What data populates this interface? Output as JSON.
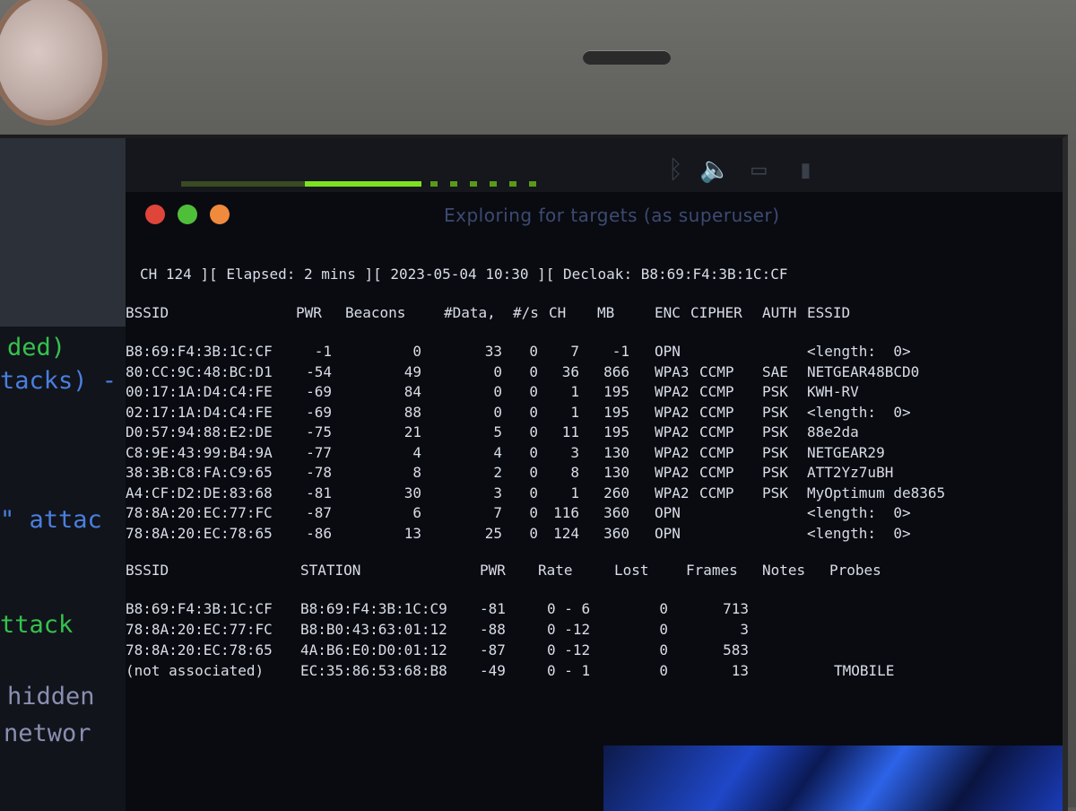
{
  "left_window": {
    "fragments": [
      "ded)",
      "tacks) -",
      "\" attac",
      "ttack",
      "hidden",
      "networ"
    ]
  },
  "terminal": {
    "title": "Exploring for targets (as superuser)",
    "status_line": "CH 124 ][ Elapsed: 2 mins ][ 2023-05-04 10:30 ][ Decloak: B8:69:F4:3B:1C:CF",
    "ap_headers": [
      "BSSID",
      "PWR",
      "Beacons",
      "#Data,",
      "#/s",
      "CH",
      "MB",
      "ENC",
      "CIPHER",
      "AUTH",
      "ESSID"
    ],
    "ap_rows": [
      [
        "B8:69:F4:3B:1C:CF",
        "-1",
        "0",
        "33",
        "0",
        "7",
        "-1",
        "OPN",
        "",
        "",
        "<length:  0>"
      ],
      [
        "80:CC:9C:48:BC:D1",
        "-54",
        "49",
        "0",
        "0",
        "36",
        "866",
        "WPA3",
        "CCMP",
        "SAE",
        "NETGEAR48BCD0"
      ],
      [
        "00:17:1A:D4:C4:FE",
        "-69",
        "84",
        "0",
        "0",
        "1",
        "195",
        "WPA2",
        "CCMP",
        "PSK",
        "KWH-RV"
      ],
      [
        "02:17:1A:D4:C4:FE",
        "-69",
        "88",
        "0",
        "0",
        "1",
        "195",
        "WPA2",
        "CCMP",
        "PSK",
        "<length:  0>"
      ],
      [
        "D0:57:94:88:E2:DE",
        "-75",
        "21",
        "5",
        "0",
        "11",
        "195",
        "WPA2",
        "CCMP",
        "PSK",
        "88e2da"
      ],
      [
        "C8:9E:43:99:B4:9A",
        "-77",
        "4",
        "4",
        "0",
        "3",
        "130",
        "WPA2",
        "CCMP",
        "PSK",
        "NETGEAR29"
      ],
      [
        "38:3B:C8:FA:C9:65",
        "-78",
        "8",
        "2",
        "0",
        "8",
        "130",
        "WPA2",
        "CCMP",
        "PSK",
        "ATT2Yz7uBH"
      ],
      [
        "A4:CF:D2:DE:83:68",
        "-81",
        "30",
        "3",
        "0",
        "1",
        "260",
        "WPA2",
        "CCMP",
        "PSK",
        "MyOptimum de8365"
      ],
      [
        "78:8A:20:EC:77:FC",
        "-87",
        "6",
        "7",
        "0",
        "116",
        "360",
        "OPN",
        "",
        "",
        "<length:  0>"
      ],
      [
        "78:8A:20:EC:78:65",
        "-86",
        "13",
        "25",
        "0",
        "124",
        "360",
        "OPN",
        "",
        "",
        "<length:  0>"
      ]
    ],
    "sta_headers": [
      "BSSID",
      "STATION",
      "PWR",
      "Rate",
      "Lost",
      "Frames",
      "Notes",
      "Probes"
    ],
    "sta_rows": [
      [
        "B8:69:F4:3B:1C:CF",
        "B8:69:F4:3B:1C:C9",
        "-81",
        "0 - 6",
        "0",
        "713",
        "",
        ""
      ],
      [
        "78:8A:20:EC:77:FC",
        "B8:B0:43:63:01:12",
        "-88",
        "0 -12",
        "0",
        "3",
        "",
        ""
      ],
      [
        "78:8A:20:EC:78:65",
        "4A:B6:E0:D0:01:12",
        "-87",
        "0 -12",
        "0",
        "583",
        "",
        ""
      ],
      [
        "(not associated)",
        "EC:35:86:53:68:B8",
        "-49",
        "0 - 1",
        "0",
        "13",
        "",
        "TMOBILE"
      ]
    ]
  },
  "colors": {
    "close": "#e0453a",
    "minimize": "#4fbf3a",
    "maximize": "#f08a3c",
    "meter": "#7ee020"
  }
}
